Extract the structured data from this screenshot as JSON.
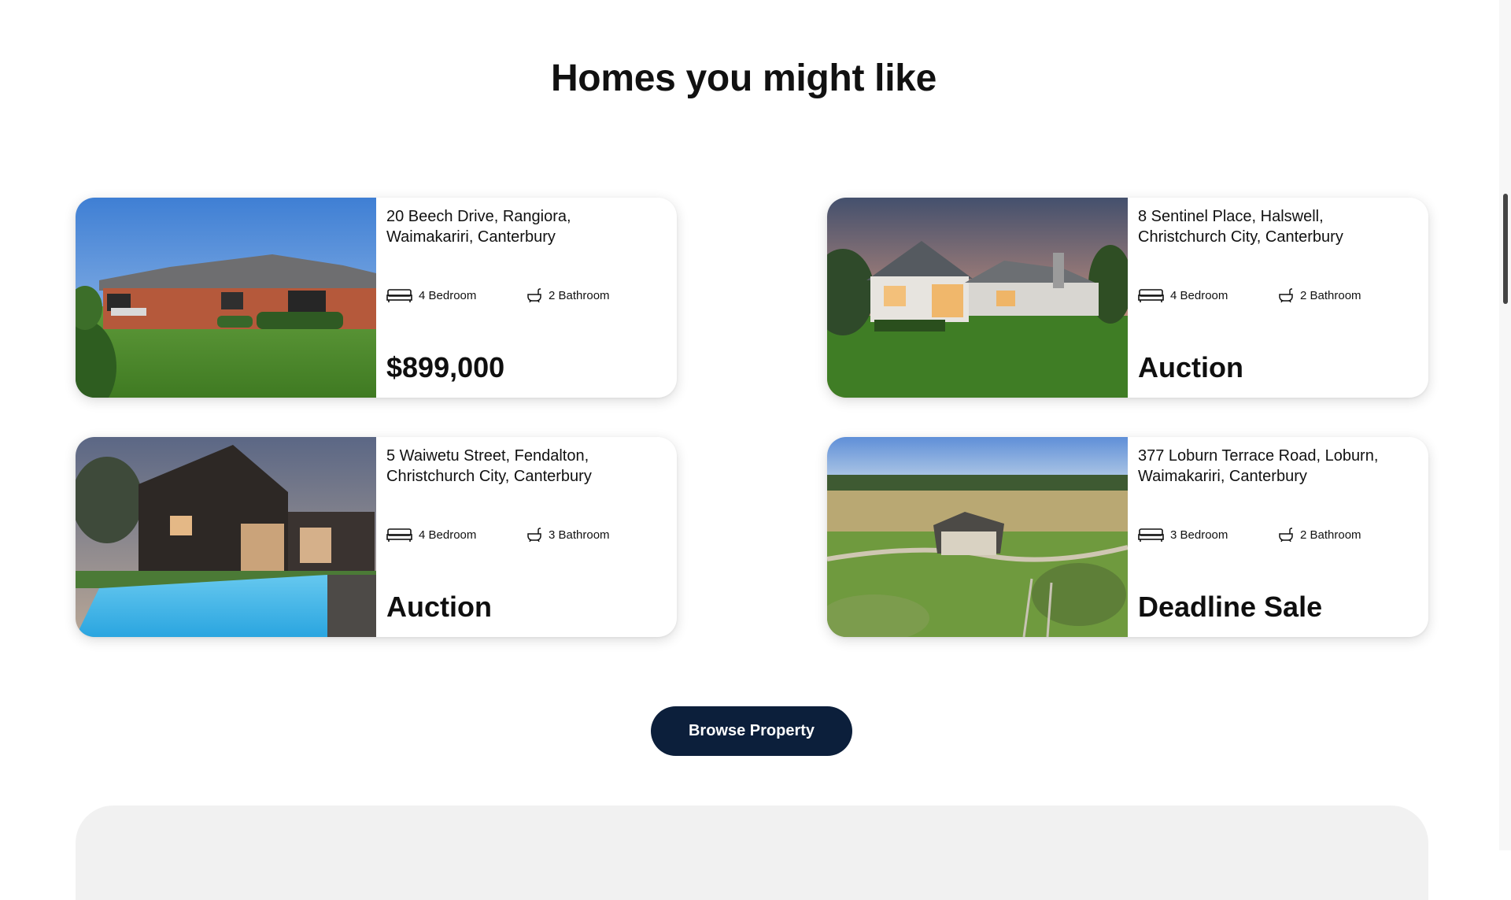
{
  "section": {
    "title": "Homes you might like"
  },
  "listings": [
    {
      "address_line1": "20 Beech Drive, Rangiora,",
      "address_line2": "Waimakariri, Canterbury",
      "bedrooms": "4 Bedroom",
      "bathrooms": "2 Bathroom",
      "price": "$899,000"
    },
    {
      "address_line1": "8 Sentinel Place, Halswell,",
      "address_line2": "Christchurch City, Canterbury",
      "bedrooms": "4 Bedroom",
      "bathrooms": "2 Bathroom",
      "price": "Auction"
    },
    {
      "address_line1": "5 Waiwetu Street, Fendalton,",
      "address_line2": "Christchurch City, Canterbury",
      "bedrooms": "4 Bedroom",
      "bathrooms": "3 Bathroom",
      "price": "Auction"
    },
    {
      "address_line1": "377 Loburn Terrace Road, Loburn,",
      "address_line2": "Waimakariri, Canterbury",
      "bedrooms": "3 Bedroom",
      "bathrooms": "2 Bathroom",
      "price": "Deadline Sale"
    }
  ],
  "actions": {
    "browse_label": "Browse Property"
  },
  "icons": {
    "bed": "bed-icon",
    "bath": "bathtub-icon"
  },
  "colors": {
    "button_bg": "#0c1f3b",
    "button_text": "#ffffff",
    "footer_panel": "#f1f1f1"
  }
}
